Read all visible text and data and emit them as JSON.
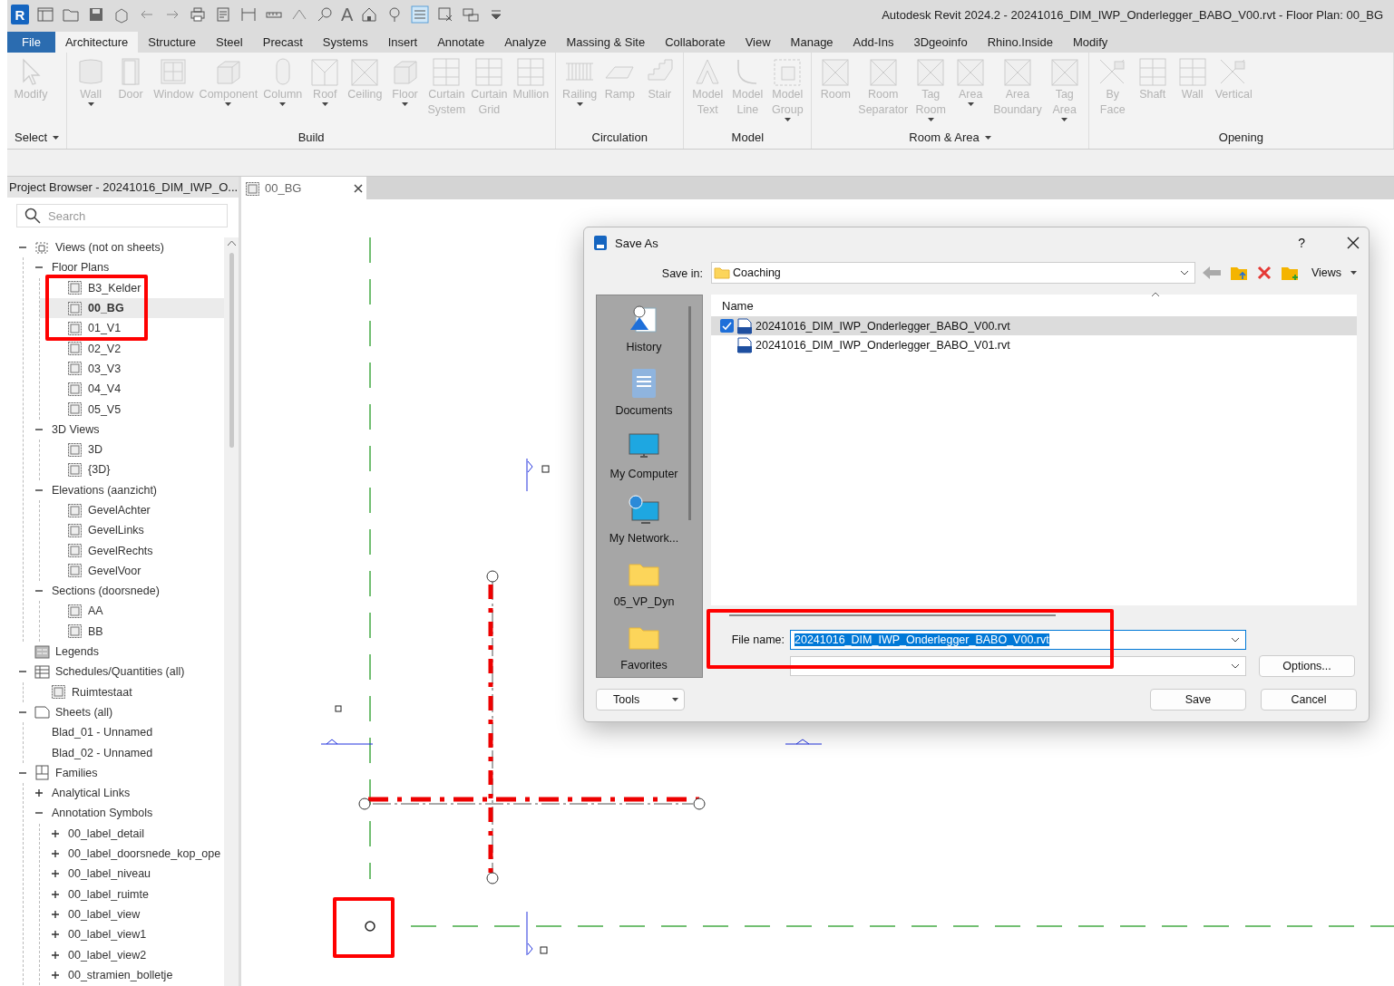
{
  "window": {
    "title": "Autodesk Revit 2024.2 - 20241016_DIM_IWP_Onderlegger_BABO_V00.rvt - Floor Plan: 00_BG"
  },
  "quick_access": {
    "app_badge": "R",
    "text_tool": "A"
  },
  "ribbon_tabs": [
    {
      "label": "File",
      "kind": "file",
      "selected": false
    },
    {
      "label": "Architecture",
      "kind": "tab",
      "selected": true
    },
    {
      "label": "Structure",
      "kind": "tab",
      "selected": false
    },
    {
      "label": "Steel",
      "kind": "tab",
      "selected": false
    },
    {
      "label": "Precast",
      "kind": "tab",
      "selected": false
    },
    {
      "label": "Systems",
      "kind": "tab",
      "selected": false
    },
    {
      "label": "Insert",
      "kind": "tab",
      "selected": false
    },
    {
      "label": "Annotate",
      "kind": "tab",
      "selected": false
    },
    {
      "label": "Analyze",
      "kind": "tab",
      "selected": false
    },
    {
      "label": "Massing & Site",
      "kind": "tab",
      "selected": false
    },
    {
      "label": "Collaborate",
      "kind": "tab",
      "selected": false
    },
    {
      "label": "View",
      "kind": "tab",
      "selected": false
    },
    {
      "label": "Manage",
      "kind": "tab",
      "selected": false
    },
    {
      "label": "Add-Ins",
      "kind": "tab",
      "selected": false
    },
    {
      "label": "3Dgeoinfo",
      "kind": "tab",
      "selected": false
    },
    {
      "label": "Rhino.Inside",
      "kind": "tab",
      "selected": false
    },
    {
      "label": "Modify",
      "kind": "tab",
      "selected": false
    }
  ],
  "ribbon_panels": [
    {
      "label": "Select",
      "dropdown": true,
      "buttons": [
        {
          "label": "Modify",
          "disabled": true,
          "dropdown": false
        }
      ]
    },
    {
      "label": "Build",
      "dropdown": false,
      "buttons": [
        {
          "label": "Wall",
          "disabled": true,
          "dropdown": true
        },
        {
          "label": "Door",
          "disabled": true,
          "dropdown": false
        },
        {
          "label": "Window",
          "disabled": true,
          "dropdown": false
        },
        {
          "label": "Component",
          "disabled": true,
          "dropdown": true
        },
        {
          "label": "Column",
          "disabled": true,
          "dropdown": true
        },
        {
          "label": "Roof",
          "disabled": true,
          "dropdown": true
        },
        {
          "label": "Ceiling",
          "disabled": true,
          "dropdown": false
        },
        {
          "label": "Floor",
          "disabled": true,
          "dropdown": true
        },
        {
          "label": "Curtain System",
          "disabled": true,
          "dropdown": false
        },
        {
          "label": "Curtain Grid",
          "disabled": true,
          "dropdown": false
        },
        {
          "label": "Mullion",
          "disabled": true,
          "dropdown": false
        }
      ]
    },
    {
      "label": "Circulation",
      "dropdown": false,
      "buttons": [
        {
          "label": "Railing",
          "disabled": true,
          "dropdown": true
        },
        {
          "label": "Ramp",
          "disabled": true,
          "dropdown": false
        },
        {
          "label": "Stair",
          "disabled": true,
          "dropdown": false
        }
      ]
    },
    {
      "label": "Model",
      "dropdown": false,
      "buttons": [
        {
          "label": "Model Text",
          "disabled": true,
          "dropdown": false
        },
        {
          "label": "Model Line",
          "disabled": true,
          "dropdown": false
        },
        {
          "label": "Model Group",
          "disabled": true,
          "dropdown": true
        }
      ]
    },
    {
      "label": "Room & Area",
      "dropdown": true,
      "buttons": [
        {
          "label": "Room",
          "disabled": true,
          "dropdown": false
        },
        {
          "label": "Room Separator",
          "disabled": true,
          "dropdown": false
        },
        {
          "label": "Tag Room",
          "disabled": true,
          "dropdown": true
        },
        {
          "label": "Area",
          "disabled": true,
          "dropdown": true
        },
        {
          "label": "Area Boundary",
          "disabled": true,
          "dropdown": false
        },
        {
          "label": "Tag Area",
          "disabled": true,
          "dropdown": true
        }
      ]
    },
    {
      "label": "Opening",
      "dropdown": false,
      "buttons": [
        {
          "label": "By Face",
          "disabled": true,
          "dropdown": false
        },
        {
          "label": "Shaft",
          "disabled": true,
          "dropdown": false
        },
        {
          "label": "Wall",
          "disabled": true,
          "dropdown": false
        },
        {
          "label": "Vertical",
          "disabled": true,
          "dropdown": false
        }
      ]
    }
  ],
  "project_browser": {
    "title": "Project Browser - 20241016_DIM_IWP_O...",
    "search": {
      "placeholder": "Search"
    },
    "tree": [
      {
        "label": "Views (not on sheets)",
        "kind": "views",
        "selected": false,
        "expanded": true,
        "children": [
          {
            "label": "Floor Plans",
            "kind": "plain",
            "selected": false,
            "expanded": true,
            "children": [
              {
                "label": "B3_Kelder",
                "kind": "view",
                "selected": false
              },
              {
                "label": "00_BG",
                "kind": "view",
                "selected": true
              },
              {
                "label": "01_V1",
                "kind": "view",
                "selected": false
              },
              {
                "label": "02_V2",
                "kind": "view",
                "selected": false
              },
              {
                "label": "03_V3",
                "kind": "view",
                "selected": false
              },
              {
                "label": "04_V4",
                "kind": "view",
                "selected": false
              },
              {
                "label": "05_V5",
                "kind": "view",
                "selected": false
              }
            ]
          },
          {
            "label": "3D Views",
            "kind": "plain",
            "selected": false,
            "expanded": true,
            "children": [
              {
                "label": "3D",
                "kind": "view",
                "selected": false
              },
              {
                "label": "{3D}",
                "kind": "view",
                "selected": false
              }
            ]
          },
          {
            "label": "Elevations (aanzicht)",
            "kind": "plain",
            "selected": false,
            "expanded": true,
            "children": [
              {
                "label": "GevelAchter",
                "kind": "view",
                "selected": false
              },
              {
                "label": "GevelLinks",
                "kind": "view",
                "selected": false
              },
              {
                "label": "GevelRechts",
                "kind": "view",
                "selected": false
              },
              {
                "label": "GevelVoor",
                "kind": "view",
                "selected": false
              }
            ]
          },
          {
            "label": "Sections (doorsnede)",
            "kind": "plain",
            "selected": false,
            "expanded": true,
            "children": [
              {
                "label": "AA",
                "kind": "view",
                "selected": false
              },
              {
                "label": "BB",
                "kind": "view",
                "selected": false
              }
            ]
          }
        ]
      },
      {
        "label": "Legends",
        "kind": "legend",
        "selected": false
      },
      {
        "label": "Schedules/Quantities (all)",
        "kind": "schedule",
        "selected": false,
        "expanded": true,
        "children": [
          {
            "label": "Ruimtestaat",
            "kind": "view",
            "selected": false
          }
        ]
      },
      {
        "label": "Sheets (all)",
        "kind": "sheet",
        "selected": false,
        "expanded": true,
        "children": [
          {
            "label": "Blad_01 - Unnamed",
            "kind": "plain",
            "selected": false
          },
          {
            "label": "Blad_02 - Unnamed",
            "kind": "plain",
            "selected": false
          }
        ]
      },
      {
        "label": "Families",
        "kind": "family",
        "selected": false,
        "expanded": true,
        "children": [
          {
            "label": "Analytical Links",
            "kind": "plain",
            "selected": false,
            "expanded": false
          },
          {
            "label": "Annotation Symbols",
            "kind": "plain",
            "selected": false,
            "expanded": true,
            "children": [
              {
                "label": "00_label_detail",
                "kind": "plain",
                "selected": false,
                "expanded": false
              },
              {
                "label": "00_label_doorsnede_kop_ope",
                "kind": "plain",
                "selected": false,
                "expanded": false
              },
              {
                "label": "00_label_niveau",
                "kind": "plain",
                "selected": false,
                "expanded": false
              },
              {
                "label": "00_label_ruimte",
                "kind": "plain",
                "selected": false,
                "expanded": false
              },
              {
                "label": "00_label_view",
                "kind": "plain",
                "selected": false,
                "expanded": false
              },
              {
                "label": "00_label_view1",
                "kind": "plain",
                "selected": false,
                "expanded": false
              },
              {
                "label": "00_label_view2",
                "kind": "plain",
                "selected": false,
                "expanded": false
              },
              {
                "label": "00_stramien_bolletje",
                "kind": "plain",
                "selected": false,
                "expanded": false
              }
            ]
          }
        ]
      }
    ]
  },
  "view_tabs": [
    {
      "label": "00_BG",
      "selected": true
    }
  ],
  "save_dialog": {
    "title": "Save As",
    "help": "?",
    "save_in_label": "Save in:",
    "save_in": "Coaching",
    "views_menu": "Views",
    "places": [
      {
        "label": "History",
        "kind": "history"
      },
      {
        "label": "Documents",
        "kind": "documents"
      },
      {
        "label": "My Computer",
        "kind": "computer"
      },
      {
        "label": "My Network...",
        "kind": "network"
      },
      {
        "label": "05_VP_Dyn",
        "kind": "folder"
      },
      {
        "label": "Favorites",
        "kind": "folder"
      }
    ],
    "column": "Name",
    "files": [
      {
        "name": "20241016_DIM_IWP_Onderlegger_BABO_V00.rvt",
        "selected": true,
        "checked": true
      },
      {
        "name": "20241016_DIM_IWP_Onderlegger_BABO_V01.rvt",
        "selected": false,
        "checked": false
      }
    ],
    "file_name_label": "File name:",
    "file_name": "20241016_DIM_IWP_Onderlegger_BABO_V00.rvt",
    "buttons": {
      "options": "Options...",
      "tools": "Tools",
      "save": "Save",
      "cancel": "Cancel"
    }
  }
}
